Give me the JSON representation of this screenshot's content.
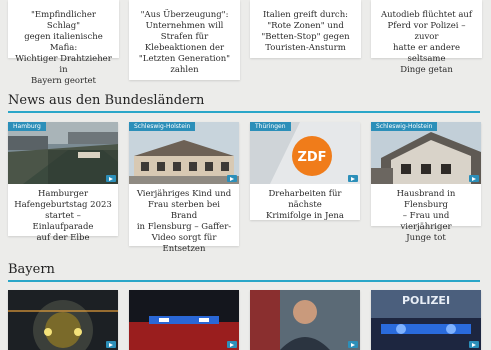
{
  "top_cards": [
    {
      "lines": [
        "\"Empfindlicher Schlag\"",
        "gegen italienische Mafia:",
        "Wichtiger Drahtzieher in",
        "Bayern geortet"
      ]
    },
    {
      "lines": [
        "\"Aus Überzeugung\":",
        "Unternehmen will",
        "Strafen für",
        "Klebeaktionen der",
        "\"Letzten Generation\"",
        "zahlen"
      ]
    },
    {
      "lines": [
        "Italien greift durch:",
        "\"Rote Zonen\" und",
        "\"Betten-Stop\" gegen",
        "Touristen-Ansturm"
      ]
    },
    {
      "lines": [
        "Autodieb flüchtet auf",
        "Pferd vor Polizei – zuvor",
        "hatte er andere seltsame",
        "Dinge getan"
      ]
    }
  ],
  "sections": {
    "bundeslaender": "News aus den Bundesländern",
    "bayern": "Bayern"
  },
  "news_cards": [
    {
      "tag": "Hamburg",
      "lines": [
        "Hamburger",
        "Hafengeburtstag 2023",
        "startet – Einlaufparade",
        "auf der Elbe"
      ]
    },
    {
      "tag": "Schleswig-Holstein",
      "lines": [
        "Vierjähriges Kind und",
        "Frau sterben bei Brand",
        "in Flensburg – Gaffer-",
        "Video sorgt für",
        "Entsetzen"
      ]
    },
    {
      "tag": "Thüringen",
      "lines": [
        "Dreharbeiten für nächste",
        "Krimifolge in Jena"
      ]
    },
    {
      "tag": "Schleswig-Holstein",
      "lines": [
        "Hausbrand in Flensburg",
        "– Frau und vierjähriger",
        "Junge tot"
      ]
    }
  ],
  "photo_texts": {
    "zdf_logo": "ZDF",
    "polizei_sign": "POLIZEI"
  }
}
